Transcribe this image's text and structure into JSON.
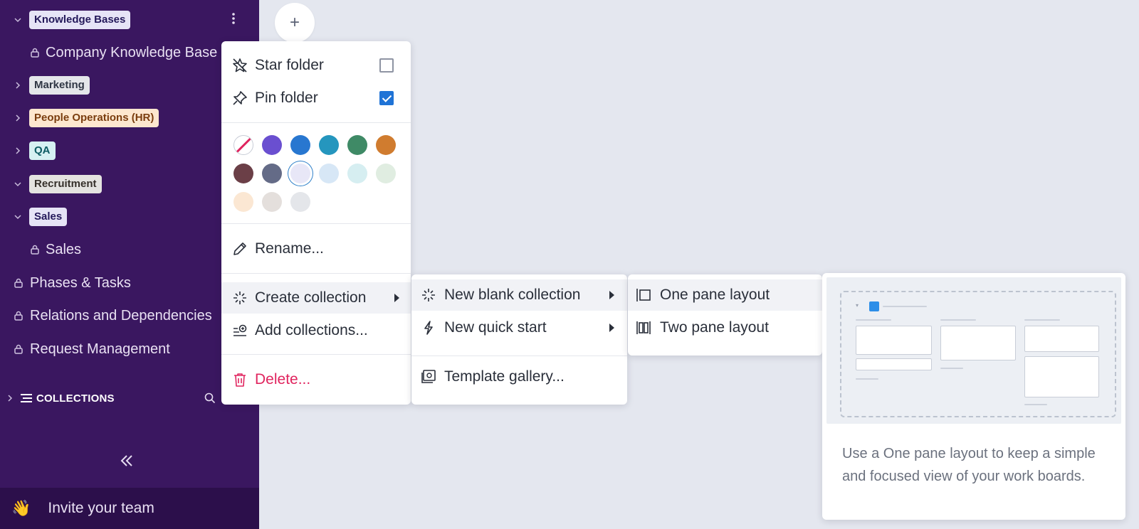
{
  "sidebar": {
    "tags": {
      "knowledge_bases": "Knowledge Bases",
      "marketing": "Marketing",
      "people_ops": "People Operations (HR)",
      "qa": "QA",
      "recruitment": "Recruitment",
      "sales": "Sales"
    },
    "items": {
      "company_kb": "Company Knowledge Base",
      "sales": "Sales",
      "phases": "Phases & Tasks",
      "relations": "Relations and Dependencies",
      "requests": "Request Management"
    },
    "collections_label": "COLLECTIONS",
    "invite_label": "Invite your team",
    "invite_icon": "👋"
  },
  "plus_button": "+",
  "context_menu": {
    "star_folder": "Star folder",
    "star_checked": false,
    "pin_folder": "Pin folder",
    "pin_checked": true,
    "colors": [
      "none",
      "#6a4fd0",
      "#2877d0",
      "#2596be",
      "#3f8a66",
      "#d07c2f",
      "#6b3f47",
      "#646b87",
      "#e8e7f7",
      "#d7e7f6",
      "#d6eef1",
      "#e0ede1",
      "#fbe7d3",
      "#e4dfdc",
      "#e4e6ea"
    ],
    "selected_color": "#e8e7f7",
    "rename": "Rename...",
    "create_collection": "Create collection",
    "add_collections": "Add collections...",
    "delete": "Delete..."
  },
  "submenu_create": {
    "new_blank": "New blank collection",
    "quick_start": "New quick start",
    "template_gallery": "Template gallery..."
  },
  "submenu_layout": {
    "one_pane": "One pane layout",
    "two_pane": "Two pane layout"
  },
  "preview": {
    "description": "Use a One pane layout to keep a simple and focused view of your work boards."
  }
}
